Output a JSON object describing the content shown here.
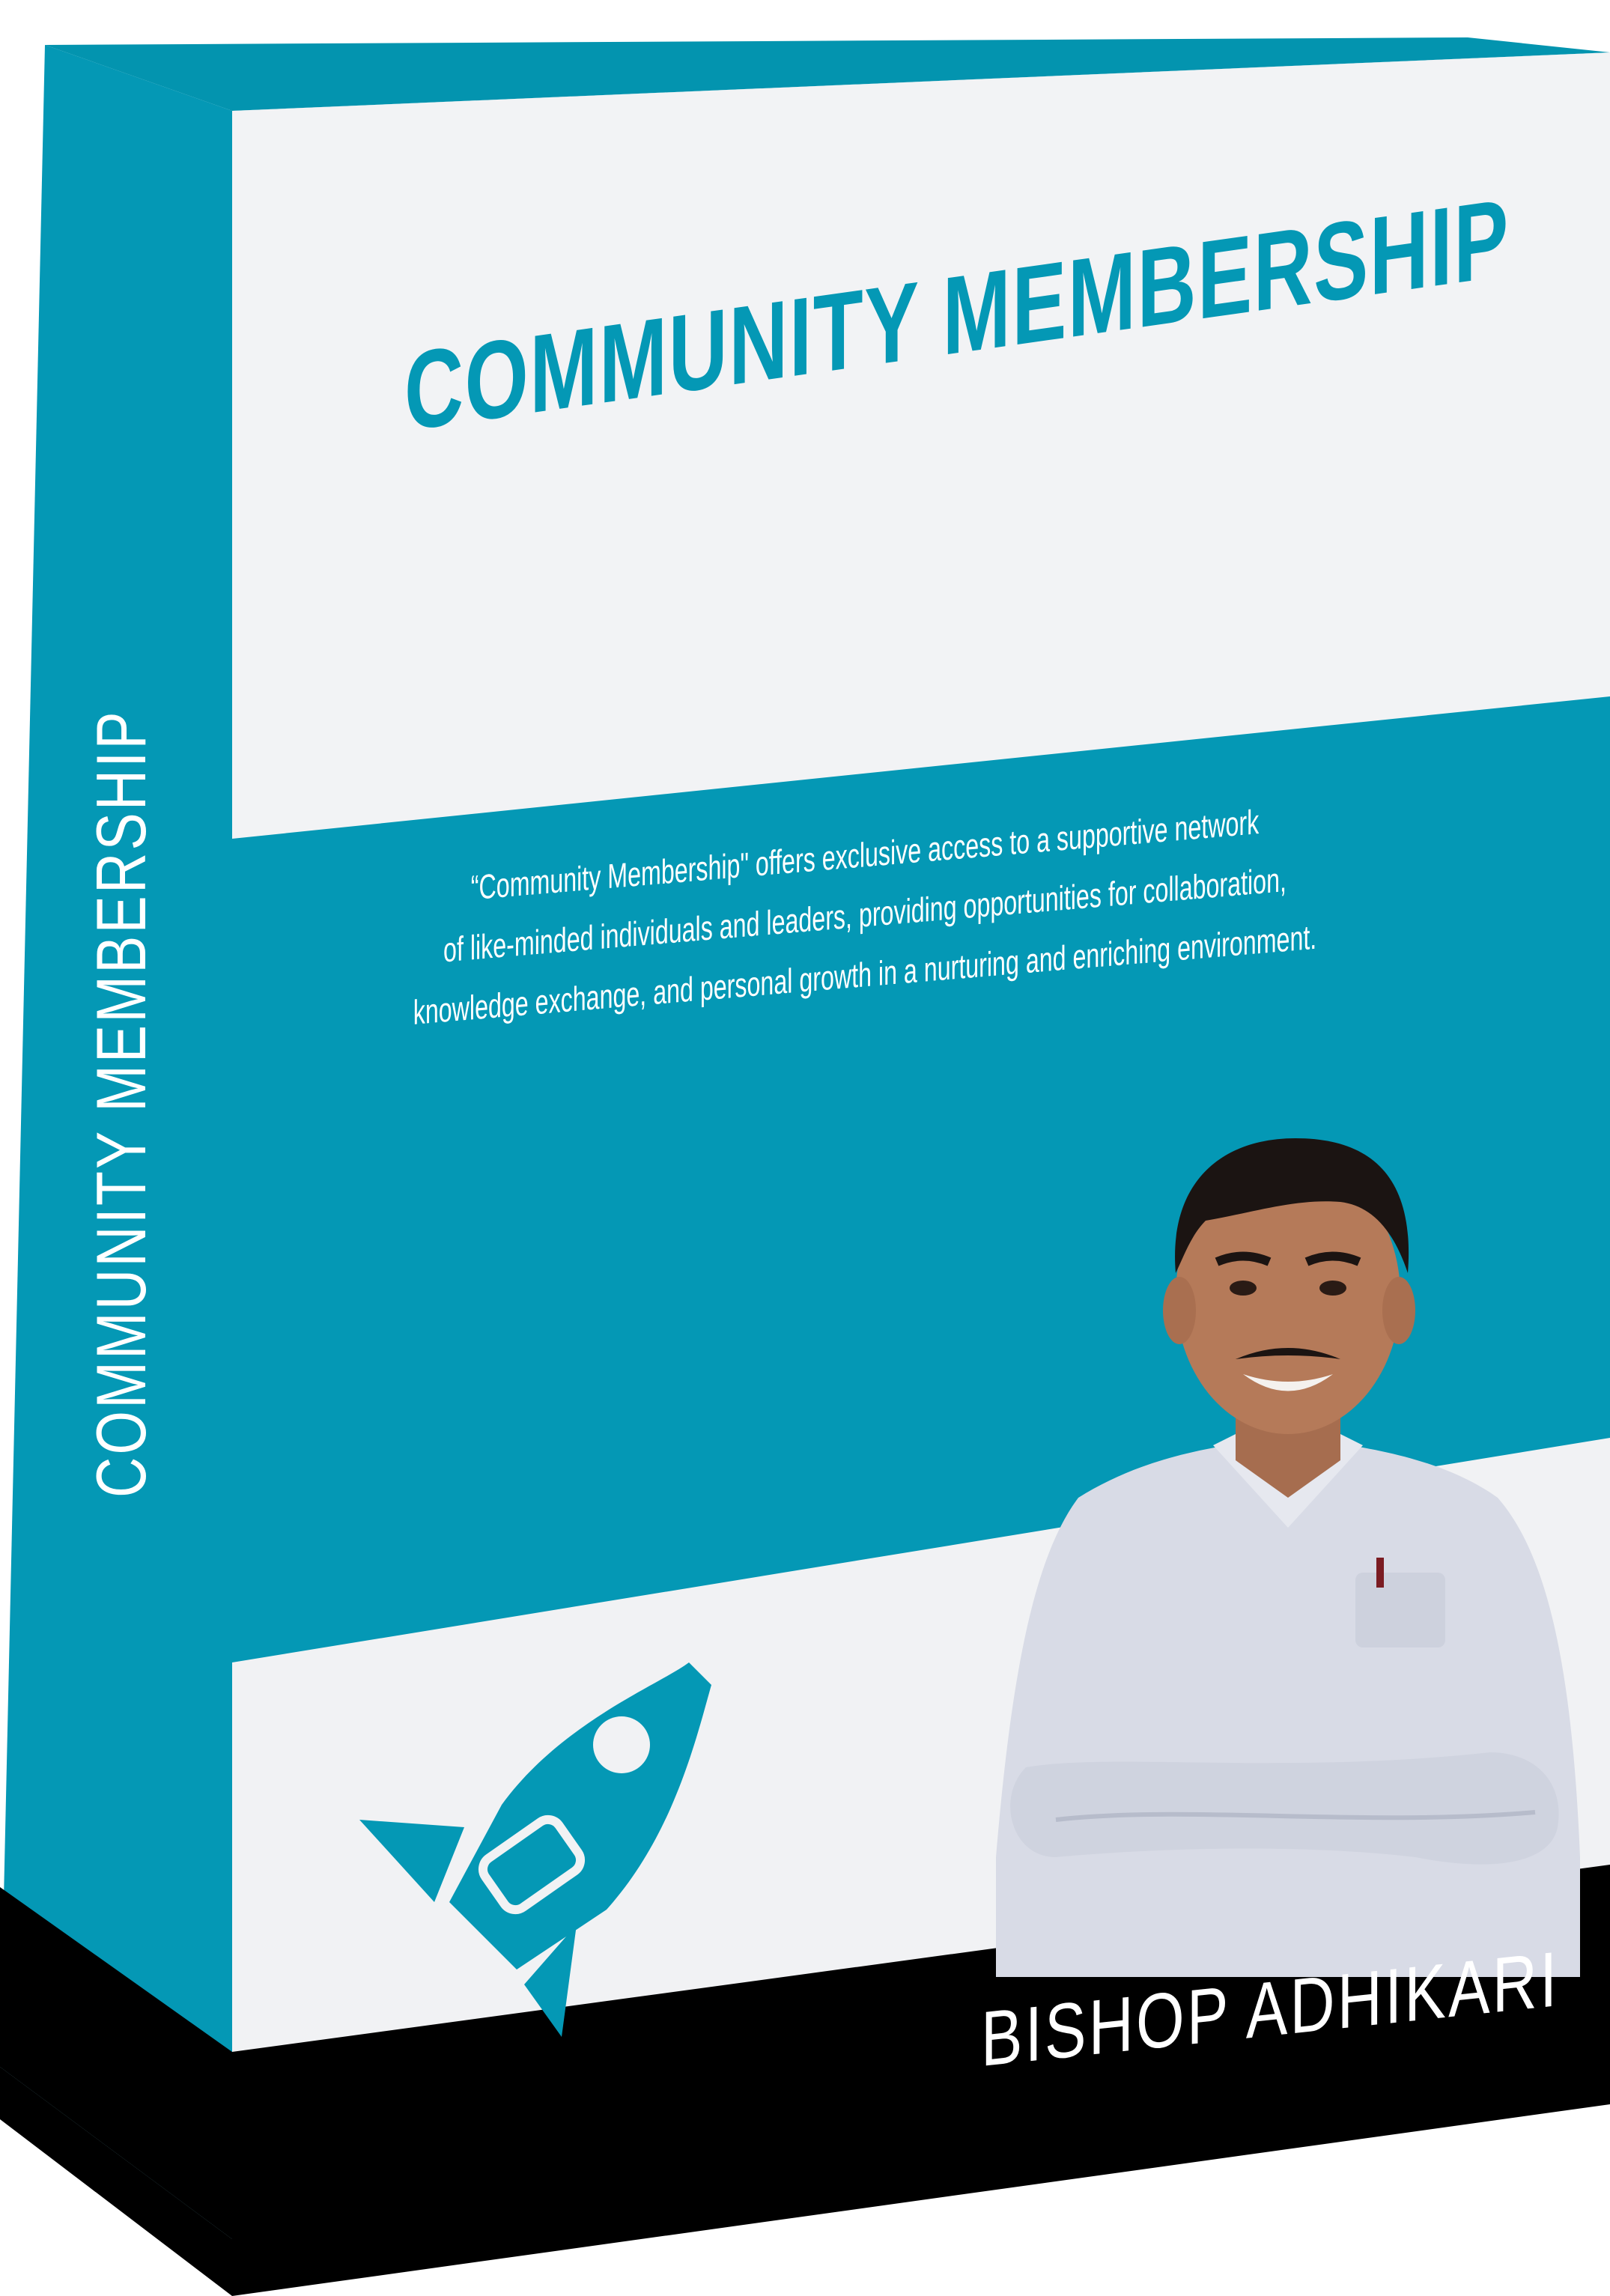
{
  "product": {
    "title": "COMMUNITY MEMBERSHIP",
    "spine_title": "COMMUNITY MEMBERSHIP",
    "description_lines": [
      "“Community Membership\" offers exclusive access to a supportive network",
      "of like-minded individuals and leaders, providing opportunities for collaboration,",
      "knowledge exchange, and personal growth in a nurturing and enriching environment."
    ],
    "author": "BISHOP ADHIKARI"
  },
  "icons": {
    "rocket": "rocket-icon"
  },
  "colors": {
    "teal": "#0498b5",
    "panel": "#f2f3f5",
    "base": "#000000",
    "text_light": "#ffffff"
  }
}
